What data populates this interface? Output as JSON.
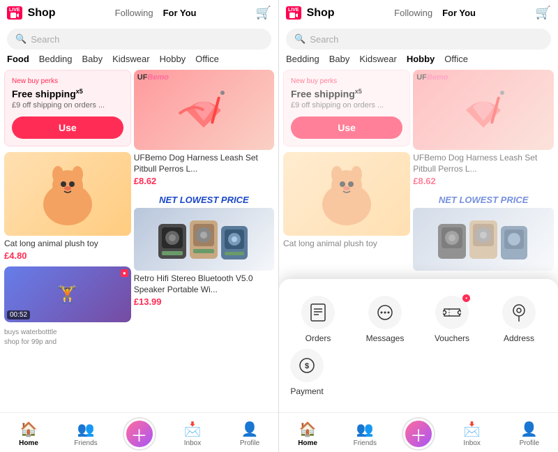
{
  "left_panel": {
    "live_badge": "LIVE",
    "shop_label": "Shop",
    "nav": [
      "Following",
      "For You"
    ],
    "search_placeholder": "Search",
    "categories": [
      "Food",
      "Bedding",
      "Baby",
      "Kidswear",
      "Hobby",
      "Office"
    ],
    "promo": {
      "label": "New buy perks",
      "title": "Free shipping",
      "sup": "x5",
      "sub": "£9 off shipping on orders ...",
      "btn": "Use"
    },
    "product1": {
      "brand": "UFBemo",
      "title": "UFBemo Dog Harness Leash Set Pitbull Perros L...",
      "price": "£8.62"
    },
    "product2": {
      "title": "Cat long animal plush toy",
      "price": "£4.80"
    },
    "product3": {
      "net_price_text": "NET LOWEST PRICE",
      "title": "Retro Hifi Stereo Bluetooth V5.0 Speaker Portable Wi...",
      "price": "£13.99"
    },
    "video_timer": "00:52",
    "video_text": "buys waterbotttle\nshop for 99p and"
  },
  "right_panel": {
    "live_badge": "LIVE",
    "shop_label": "Shop",
    "nav": [
      "Following",
      "For You"
    ],
    "search_placeholder": "Search",
    "categories": [
      "Bedding",
      "Baby",
      "Kidswear",
      "Hobby",
      "Office"
    ],
    "promo": {
      "label": "New buy perks",
      "title": "Free shipping",
      "sup": "x5",
      "sub": "£9 off shipping on orders ...",
      "btn": "Use"
    },
    "product1": {
      "brand": "UFBemo",
      "title": "UFBemo Dog Harness Leash Set Pitbull Perros L...",
      "price": "£8.62"
    },
    "product2": {
      "title": "Cat long animal plush toy"
    },
    "net_price_text": "NET LOWEST PRICE"
  },
  "popup_menu": {
    "items": [
      {
        "icon": "📋",
        "label": "Orders",
        "badge": ""
      },
      {
        "icon": "💬",
        "label": "Messages",
        "badge": ""
      },
      {
        "icon": "🎫",
        "label": "Vouchers",
        "badge": "•"
      },
      {
        "icon": "📍",
        "label": "Address",
        "badge": ""
      }
    ],
    "row2": [
      {
        "icon": "💲",
        "label": "Payment",
        "badge": ""
      }
    ]
  },
  "bottom_nav": {
    "items": [
      {
        "icon": "🏠",
        "label": "Home",
        "active": true
      },
      {
        "icon": "👥",
        "label": "Friends",
        "active": false
      },
      {
        "icon": "+",
        "label": "",
        "add": true
      },
      {
        "icon": "📩",
        "label": "Inbox",
        "active": false
      },
      {
        "icon": "👤",
        "label": "Profile",
        "active": false
      }
    ]
  }
}
